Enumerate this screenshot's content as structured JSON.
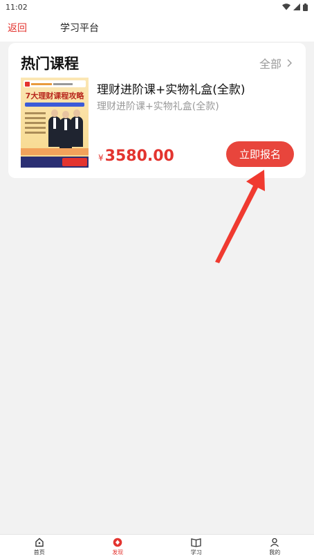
{
  "status_bar": {
    "time": "11:02"
  },
  "nav": {
    "back_label": "返回",
    "title": "学习平台"
  },
  "section": {
    "title": "热门课程",
    "more_label": "全部"
  },
  "course": {
    "title": "理财进阶课+实物礼盒(全款)",
    "subtitle": "理财进阶课+实物礼盒(全款)",
    "price_symbol": "¥",
    "price": "3580.00",
    "signup_label": "立即报名",
    "thumbnail_headline": "7大理财课程攻略"
  },
  "tabs": [
    {
      "label": "首页",
      "icon": "home-icon"
    },
    {
      "label": "发现",
      "icon": "discover-icon"
    },
    {
      "label": "学习",
      "icon": "book-icon"
    },
    {
      "label": "我的",
      "icon": "user-icon"
    }
  ],
  "active_tab": "发现",
  "colors": {
    "accent": "#e3342f",
    "button": "#e8453c",
    "background": "#f2f2f2"
  }
}
